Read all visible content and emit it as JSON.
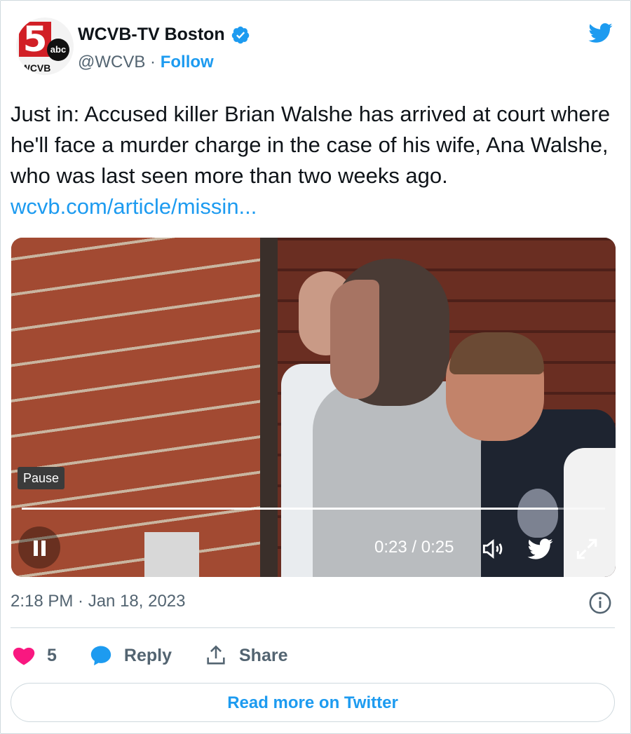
{
  "account": {
    "logo_number": "5",
    "logo_network": "abc",
    "logo_callsign": "WCVB",
    "name": "WCVB-TV Boston",
    "handle": "@WCVB",
    "separator": "·",
    "follow_label": "Follow"
  },
  "tweet": {
    "text": "Just in: Accused killer Brian Walshe has arrived at court where he'll face a murder charge in the case of his wife, Ana Walshe, who was last seen more than two weeks ago.",
    "link_text": "wcvb.com/article/missin..."
  },
  "video": {
    "tooltip": "Pause",
    "time": "0:23 / 0:25",
    "progress": 0.92
  },
  "meta": {
    "timestamp": "2:18 PM · Jan 18, 2023"
  },
  "actions": {
    "like_count": "5",
    "reply_label": "Reply",
    "share_label": "Share"
  },
  "read_more_label": "Read more on Twitter",
  "colors": {
    "accent": "#1d9bf0",
    "like": "#f91880",
    "text": "#0f1419",
    "muted": "#536471"
  }
}
